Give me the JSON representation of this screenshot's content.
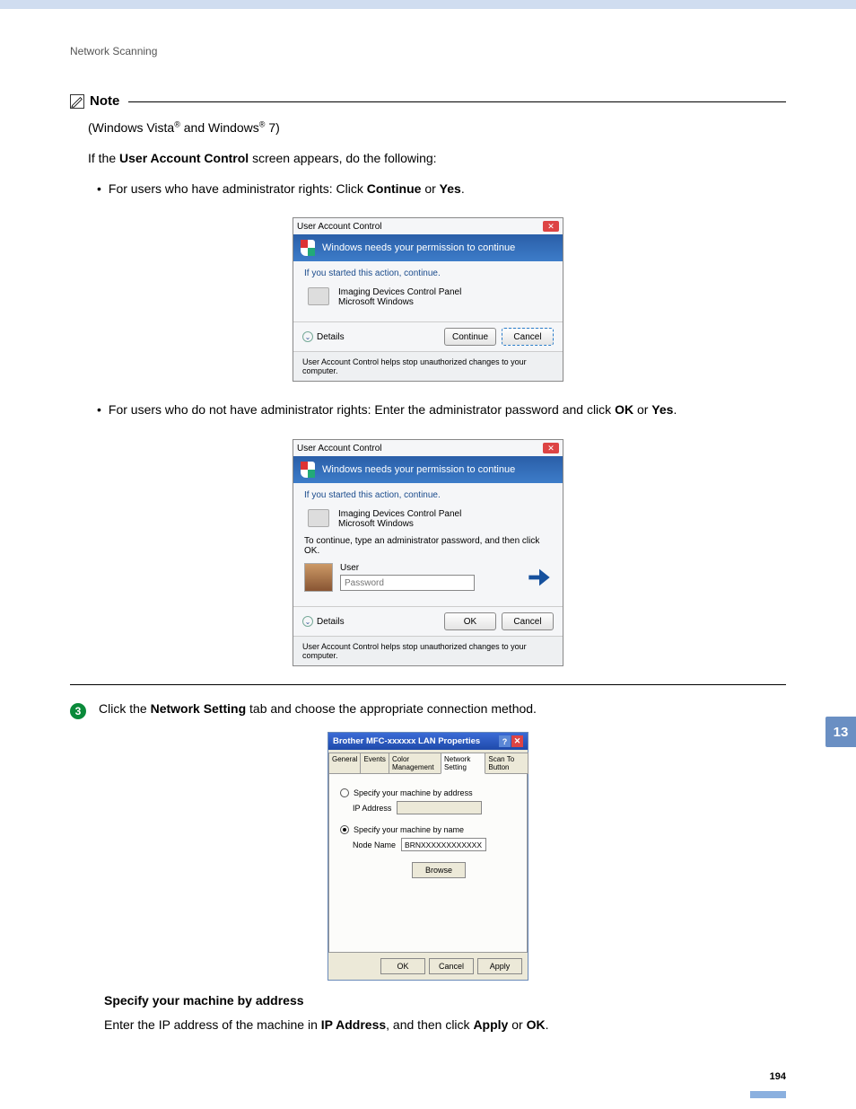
{
  "header": "Network Scanning",
  "note_label": "Note",
  "os_line_prefix": "(Windows Vista",
  "os_line_mid": " and Windows",
  "os_line_suffix": " 7)",
  "reg_mark": "®",
  "uac_intro_prefix": "If the ",
  "uac_intro_bold": "User Account Control",
  "uac_intro_suffix": " screen appears, do the following:",
  "bullet1_prefix": "For users who have administrator rights: Click ",
  "bullet1_b1": "Continue",
  "bullet1_mid": " or ",
  "bullet1_b2": "Yes",
  "dot": ".",
  "bullet2_prefix": "For users who do not have administrator rights: Enter the administrator password and click ",
  "bullet2_b1": "OK",
  "bullet2_mid": " or ",
  "bullet2_b2": "Yes",
  "uac": {
    "title": "User Account Control",
    "banner": "Windows needs your permission to continue",
    "started": "If you started this action, continue.",
    "program_name": "Imaging Devices Control Panel",
    "publisher": "Microsoft Windows",
    "continue_msg": "To continue, type an administrator password, and then click OK.",
    "user_label": "User",
    "password_placeholder": "Password",
    "details": "Details",
    "continue_btn": "Continue",
    "cancel_btn": "Cancel",
    "ok_btn": "OK",
    "help": "User Account Control helps stop unauthorized changes to your computer."
  },
  "step3_num": "3",
  "step3_prefix": "Click the ",
  "step3_bold": "Network Setting",
  "step3_suffix": " tab and choose the appropriate connection method.",
  "prop": {
    "title": "Brother MFC-xxxxxx  LAN Properties",
    "tabs": [
      "General",
      "Events",
      "Color Management",
      "Network Setting",
      "Scan To Button"
    ],
    "radio1": "Specify your machine by address",
    "ip_label": "IP Address",
    "radio2": "Specify your machine by name",
    "node_label": "Node Name",
    "node_value": "BRNXXXXXXXXXXXX",
    "browse": "Browse",
    "ok": "OK",
    "cancel": "Cancel",
    "apply": "Apply"
  },
  "spec_title": "Specify your machine by address",
  "spec_prefix": "Enter the IP address of the machine in ",
  "spec_b1": "IP Address",
  "spec_mid1": ", and then click ",
  "spec_b2": "Apply",
  "spec_mid2": " or ",
  "spec_b3": "OK",
  "side_tab": "13",
  "page_num": "194"
}
